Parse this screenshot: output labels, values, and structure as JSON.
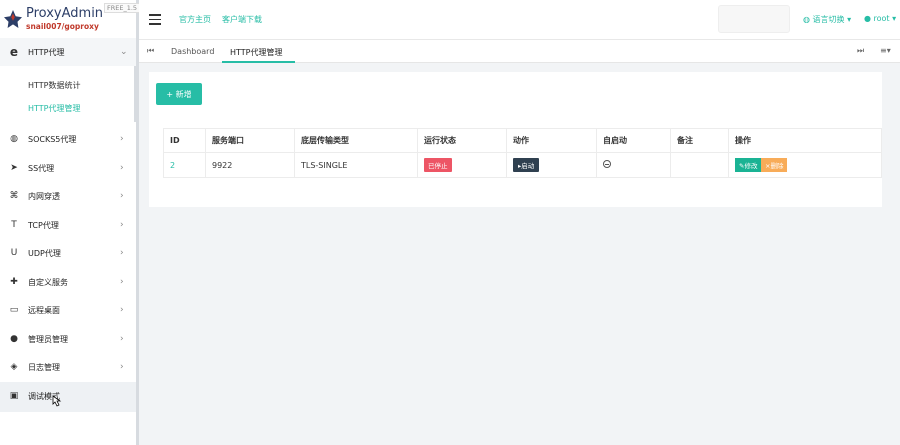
{
  "brand": {
    "name": "ProxyAdmin",
    "subtitle": "snail007/goproxy",
    "version": "FREE_1.5"
  },
  "header": {
    "links": [
      "官方主页",
      "客户端下载"
    ],
    "language_label": "语言切换",
    "user_label": "root"
  },
  "sidebar": {
    "items": [
      {
        "icon": "e",
        "label": "HTTP代理",
        "open": true
      },
      {
        "icon": "globe-icon",
        "label": "SOCKS5代理"
      },
      {
        "icon": "send-icon",
        "label": "SS代理"
      },
      {
        "icon": "network-icon",
        "label": "内网穿透"
      },
      {
        "icon": "t-icon",
        "label": "TCP代理"
      },
      {
        "icon": "u-icon",
        "label": "UDP代理"
      },
      {
        "icon": "puzzle-icon",
        "label": "自定义服务"
      },
      {
        "icon": "desktop-icon",
        "label": "远程桌面"
      },
      {
        "icon": "user-icon",
        "label": "管理员管理"
      },
      {
        "icon": "log-icon",
        "label": "日志管理"
      },
      {
        "icon": "debug-icon",
        "label": "调试模式"
      }
    ],
    "submenu": [
      {
        "label": "HTTP数据统计",
        "active": false
      },
      {
        "label": "HTTP代理管理",
        "active": true
      }
    ]
  },
  "tabs": {
    "items": [
      "Dashboard",
      "HTTP代理管理"
    ],
    "active": "HTTP代理管理"
  },
  "main": {
    "add_button": "+ 新增",
    "table": {
      "headers": [
        "ID",
        "服务端口",
        "底层传输类型",
        "运行状态",
        "动作",
        "自启动",
        "备注",
        "操作"
      ],
      "rows": [
        {
          "id": "2",
          "port": "9922",
          "transport": "TLS-SINGLE",
          "status": "已停止",
          "action": "启动",
          "autostart": "",
          "remark": "",
          "edit": "修改",
          "delete": "删除"
        }
      ]
    }
  },
  "colors": {
    "accent": "#27bda6",
    "stopped": "#ed5565",
    "start_button": "#2f4050",
    "edit_button": "#1ab394",
    "delete_button": "#f8ac59"
  }
}
